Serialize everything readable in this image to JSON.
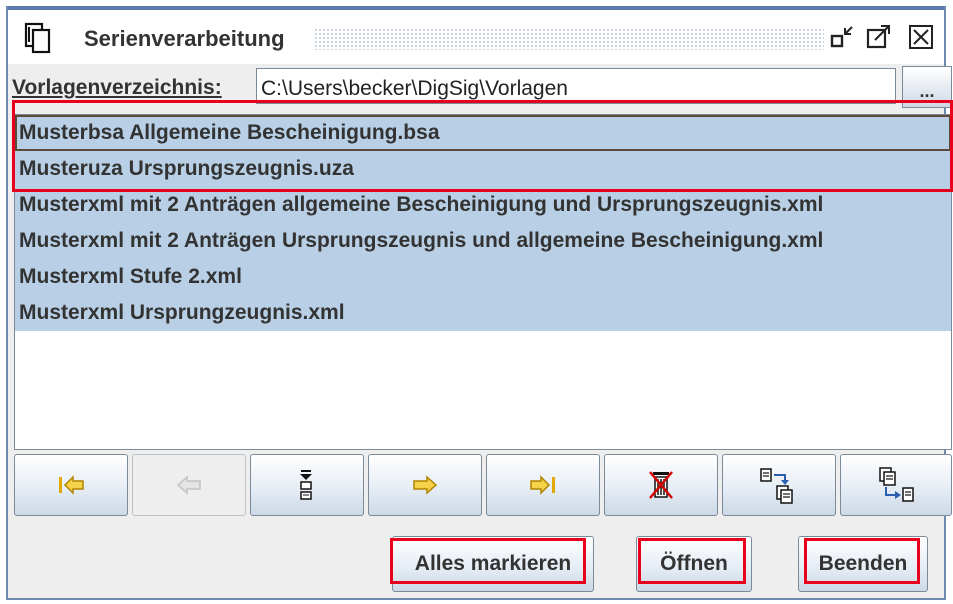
{
  "window": {
    "title": "Serienverarbeitung",
    "icon": "document-copy-icon",
    "controls": [
      "minimize-icon",
      "maximize-icon",
      "close-icon"
    ]
  },
  "directory": {
    "label": "Vorlagenverzeichnis:",
    "value": "C:\\Users\\becker\\DigSig\\Vorlagen",
    "browse_label": "..."
  },
  "templates": {
    "items": [
      {
        "label": "Musterbsa Allgemeine Bescheinigung.bsa",
        "selected": true,
        "focused": true
      },
      {
        "label": "Musteruza Ursprungszeugnis.uza",
        "selected": true
      },
      {
        "label": "Musterxml mit 2 Anträgen allgemeine Bescheinigung und Ursprungszeugnis.xml",
        "selected": true
      },
      {
        "label": "Musterxml mit 2 Anträgen Ursprungszeugnis und allgemeine Bescheinigung.xml",
        "selected": true
      },
      {
        "label": "Musterxml Stufe 2.xml",
        "selected": true
      },
      {
        "label": "Musterxml Ursprungzeugnis.xml",
        "selected": true
      }
    ]
  },
  "toolbar": {
    "buttons": [
      {
        "icon": "first-arrow-icon",
        "enabled": true
      },
      {
        "icon": "previous-arrow-icon",
        "enabled": false
      },
      {
        "icon": "move-down-icon",
        "enabled": true
      },
      {
        "icon": "next-arrow-icon",
        "enabled": true
      },
      {
        "icon": "last-arrow-icon",
        "enabled": true
      },
      {
        "icon": "delete-trash-icon",
        "enabled": true
      },
      {
        "icon": "add-to-list-icon",
        "enabled": true
      },
      {
        "icon": "extract-from-list-icon",
        "enabled": true
      }
    ]
  },
  "actions": {
    "select_all_label": "Alles markieren",
    "open_label": "Öffnen",
    "exit_label": "Beenden"
  },
  "colors": {
    "selection": "#b8cfe5",
    "highlight": "#e8001c",
    "arrow_yellow": "#f5d24a",
    "delete_red": "#d40000"
  }
}
